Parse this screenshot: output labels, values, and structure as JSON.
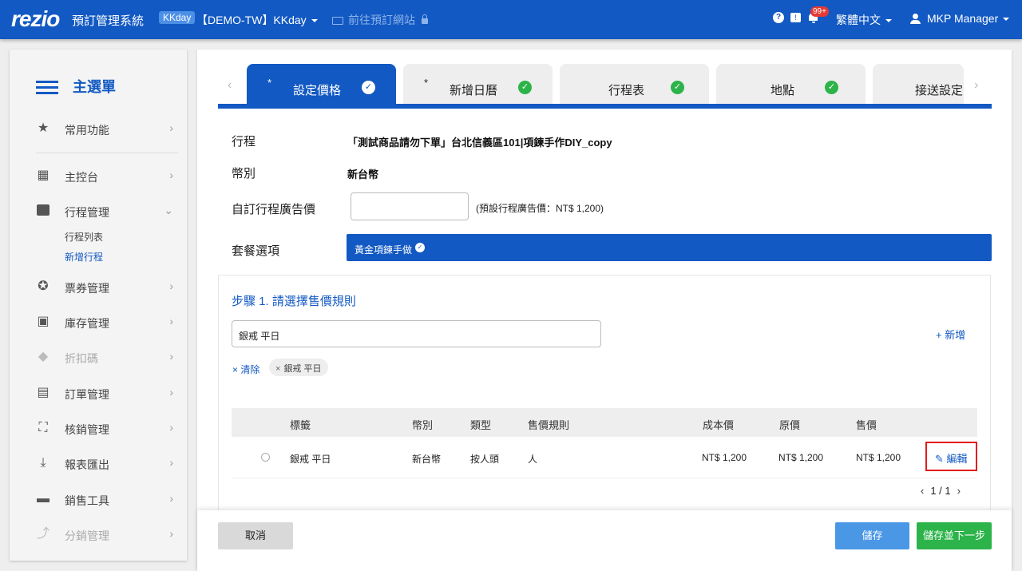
{
  "topbar": {
    "logo": "rezio",
    "system_name": "預訂管理系統",
    "channel_badge": "KKday",
    "store_name": "【DEMO-TW】KKday",
    "goto_site": "前往預訂網站",
    "help_glyph": "?",
    "notification_count": "99+",
    "language": "繁體中文",
    "user_name": "MKP Manager",
    "brand_color": "#1259c3"
  },
  "sidebar": {
    "title": "主選單",
    "items": [
      {
        "label": "常用功能",
        "icon": "star-icon"
      },
      {
        "label": "主控台",
        "icon": "dashboard-icon"
      },
      {
        "label": "行程管理",
        "icon": "folder-star-icon"
      },
      {
        "label": "票券管理",
        "icon": "ticket-icon"
      },
      {
        "label": "庫存管理",
        "icon": "calendar-icon"
      },
      {
        "label": "折扣碼",
        "icon": "tag-icon"
      },
      {
        "label": "訂單管理",
        "icon": "document-icon"
      },
      {
        "label": "核銷管理",
        "icon": "scan-icon"
      },
      {
        "label": "報表匯出",
        "icon": "download-icon"
      },
      {
        "label": "銷售工具",
        "icon": "store-icon"
      },
      {
        "label": "分銷管理",
        "icon": "split-icon"
      }
    ],
    "sub_items": [
      "行程列表",
      "新增行程"
    ]
  },
  "tabs": [
    {
      "label": "設定價格",
      "star": "*",
      "active": true
    },
    {
      "label": "新增日曆",
      "star": "*",
      "active": false
    },
    {
      "label": "行程表",
      "star": "",
      "active": false
    },
    {
      "label": "地點",
      "star": "",
      "active": false
    },
    {
      "label": "接送設定",
      "star": "",
      "active": false
    }
  ],
  "form": {
    "trip_label": "行程",
    "trip_value": "「測試商品請勿下單」台北信義區101|項鍊手作DIY_copy",
    "currency_label": "幣別",
    "currency_value": "新台幣",
    "ad_price_label": "自訂行程廣告價",
    "ad_price_value": "",
    "ad_price_note": "(預設行程廣告價：NT$ 1,200)",
    "package_label": "套餐選項",
    "package_selected": "黃金項鍊手做"
  },
  "step": {
    "title": "步驟 1. 請選擇售價規則",
    "rule_input_value": "銀戒 平日",
    "add_label": "+ 新增",
    "clear_label": "× 清除",
    "chip_label": "銀戒 平日"
  },
  "table": {
    "headers": [
      "標籤",
      "幣別",
      "類型",
      "售價規則",
      "成本價",
      "原價",
      "售價"
    ],
    "rows": [
      {
        "tag": "銀戒 平日",
        "currency": "新台幣",
        "type": "按人頭",
        "rule": "人",
        "cost": "NT$ 1,200",
        "original": "NT$ 1,200",
        "price": "NT$ 1,200",
        "edit": "編輯"
      }
    ],
    "pagination": "1 / 1"
  },
  "actions": {
    "cancel": "取消",
    "save": "儲存",
    "save_next": "儲存並下一步"
  }
}
